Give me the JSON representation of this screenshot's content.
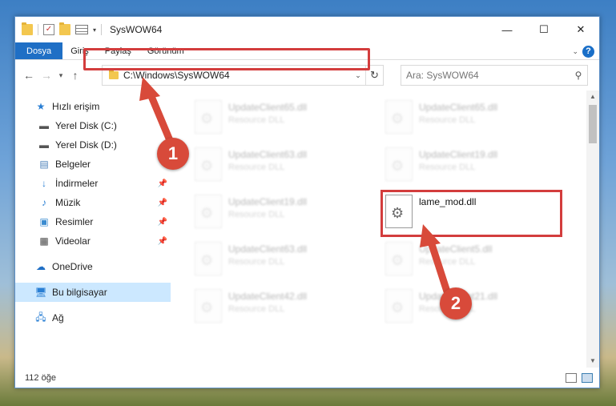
{
  "window": {
    "title": "SysWOW64",
    "controls": {
      "minimize": "—",
      "maximize": "☐",
      "close": "✕"
    },
    "help": "?"
  },
  "ribbon": {
    "tabs": [
      "Dosya",
      "Giriş",
      "Paylaş",
      "Görünüm"
    ]
  },
  "address": {
    "path": "C:\\Windows\\SysWOW64",
    "search_placeholder": "Ara: SysWOW64"
  },
  "nav": {
    "items": [
      {
        "label": "Hızlı erişim",
        "icon": "star-icon"
      },
      {
        "label": "Yerel Disk (C:)",
        "icon": "drive-icon"
      },
      {
        "label": "Yerel Disk (D:)",
        "icon": "drive-icon"
      },
      {
        "label": "Belgeler",
        "icon": "documents-icon"
      },
      {
        "label": "İndirmeler",
        "icon": "downloads-icon"
      },
      {
        "label": "Müzik",
        "icon": "music-icon"
      },
      {
        "label": "Resimler",
        "icon": "pictures-icon"
      },
      {
        "label": "Videolar",
        "icon": "videos-icon"
      },
      {
        "label": "OneDrive",
        "icon": "cloud-icon"
      },
      {
        "label": "Bu bilgisayar",
        "icon": "computer-icon"
      },
      {
        "label": "Ağ",
        "icon": "network-icon"
      }
    ]
  },
  "files": [
    {
      "name": "UpdateClient65.dll",
      "type": "Resource DLL"
    },
    {
      "name": "UpdateClient65.dll",
      "type": "Resource DLL"
    },
    {
      "name": "UpdateClient63.dll",
      "type": "Resource DLL"
    },
    {
      "name": "UpdateClient19.dll",
      "type": "Resource DLL"
    },
    {
      "name": "UpdateClient19.dll",
      "type": "Resource DLL"
    },
    {
      "name": "lame_mod.dll",
      "type": ""
    },
    {
      "name": "UpdateClient63.dll",
      "type": "Resource DLL"
    },
    {
      "name": "UpdateClient5.dll",
      "type": "Resource DLL"
    },
    {
      "name": "UpdateClient42.dll",
      "type": "Resource DLL"
    },
    {
      "name": "UpdateClient21.dll",
      "type": "Resource DLL"
    }
  ],
  "status": {
    "count": "112 öğe"
  },
  "annotations": {
    "step1": "1",
    "step2": "2",
    "color": "#d33d3d"
  }
}
